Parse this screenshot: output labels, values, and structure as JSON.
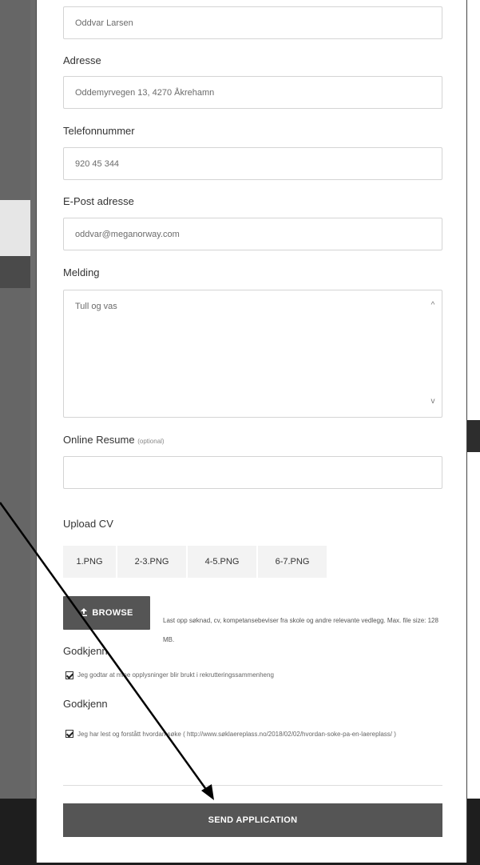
{
  "form": {
    "name_value": "Oddvar Larsen",
    "address_label": "Adresse",
    "address_value": "Oddemyrvegen 13, 4270 Åkrehamn",
    "phone_label": "Telefonnummer",
    "phone_value": "920 45 344",
    "email_label": "E-Post adresse",
    "email_value": "oddvar@meganorway.com",
    "message_label": "Melding",
    "message_value": "Tull og vas",
    "resume_label": "Online Resume",
    "resume_optional": "(optional)",
    "resume_value": "",
    "upload_label": "Upload CV",
    "files": [
      "1.PNG",
      "2-3.PNG",
      "4-5.PNG",
      "6-7.PNG"
    ],
    "browse_label": "BROWSE",
    "upload_hint": "Last opp søknad, cv, kompetansebeviser fra skole og andre relevante vedlegg. Max. file size: 128 MB.",
    "consent1_label": "Godkjenn",
    "consent1_text": "Jeg godtar at mine opplysninger blir brukt i rekrutteringssammenheng",
    "consent2_label": "Godkjenn",
    "consent2_text": "Jeg har lest og forstått hvordan søke ( http://www.søklaereplass.no/2018/02/02/hvordan-soke-pa-en-laereplass/ )",
    "submit_label": "SEND APPLICATION"
  },
  "colors": {
    "button_bg": "#555555",
    "backdrop": "#6c6c6c",
    "border": "#d4d4d4"
  }
}
